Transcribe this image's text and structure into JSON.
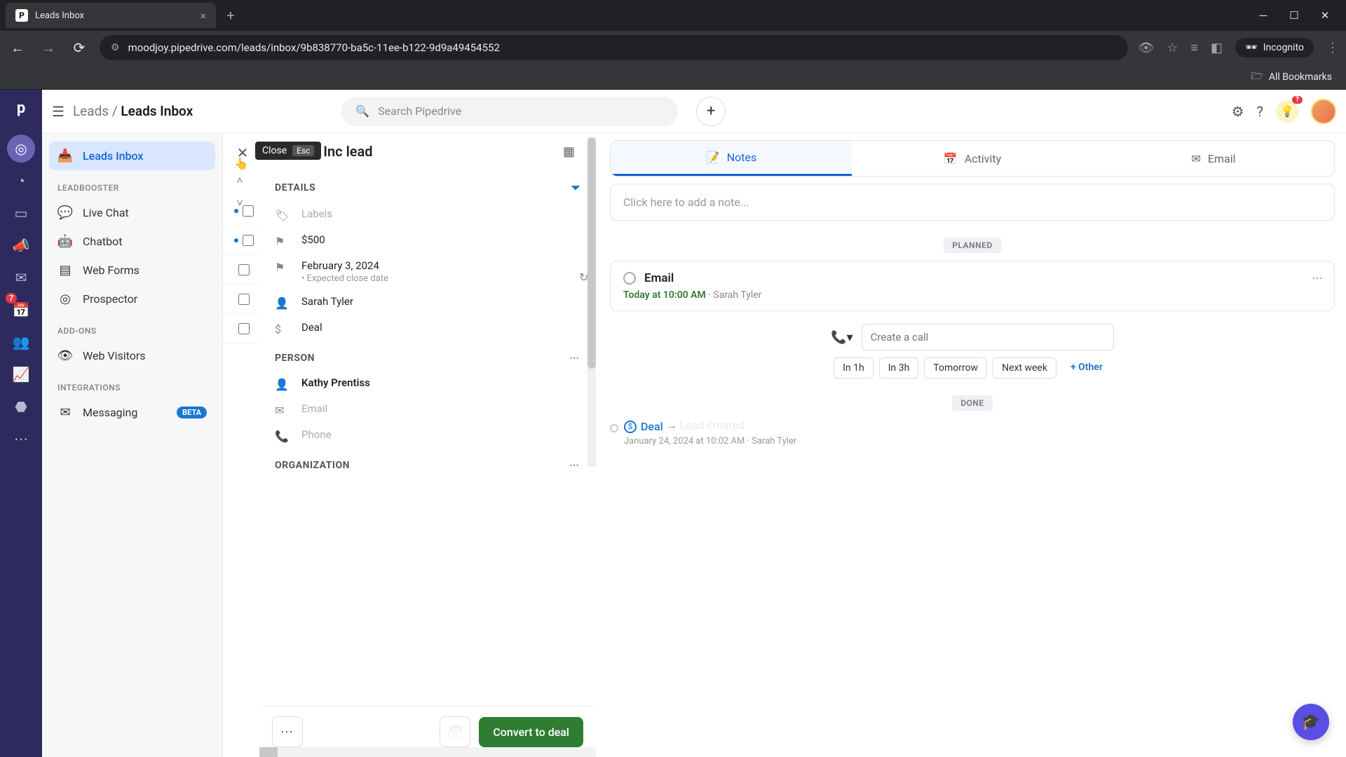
{
  "browser": {
    "tab_title": "Leads Inbox",
    "url": "moodjoy.pipedrive.com/leads/inbox/9b838770-ba5c-11ee-b122-9d9a49454552",
    "incognito_label": "Incognito",
    "all_bookmarks": "All Bookmarks"
  },
  "topbar": {
    "breadcrumb_root": "Leads",
    "breadcrumb_current": "Leads Inbox",
    "search_placeholder": "Search Pipedrive",
    "notification_count": "?"
  },
  "rail": {
    "badge_count": "7"
  },
  "sidebar": {
    "items": [
      {
        "label": "Leads Inbox",
        "active": true
      },
      {
        "label": "Live Chat"
      },
      {
        "label": "Chatbot"
      },
      {
        "label": "Web Forms"
      },
      {
        "label": "Prospector"
      },
      {
        "label": "Web Visitors"
      },
      {
        "label": "Messaging",
        "badge": "BETA"
      }
    ],
    "heading_leadbooster": "LEADBOOSTER",
    "heading_addons": "ADD-ONS",
    "heading_integrations": "INTEGRATIONS"
  },
  "detail": {
    "lead_title_suffix": "s Inc lead",
    "tooltip_close": "Close",
    "tooltip_esc": "Esc",
    "section_details": "DETAILS",
    "labels_placeholder": "Labels",
    "value": "$500",
    "close_date": "February 3, 2024",
    "close_date_sub": "Expected close date",
    "owner": "Sarah Tyler",
    "deal": "Deal",
    "section_person": "PERSON",
    "person_name": "Kathy Prentiss",
    "email_placeholder": "Email",
    "phone_placeholder": "Phone",
    "section_org": "ORGANIZATION",
    "convert_label": "Convert to deal"
  },
  "activity": {
    "tabs": {
      "notes": "Notes",
      "activity": "Activity",
      "email": "Email"
    },
    "note_placeholder": "Click here to add a note...",
    "label_planned": "PLANNED",
    "label_done": "DONE",
    "planned_card": {
      "title": "Email",
      "when": "Today at 10:00 AM",
      "who": "Sarah Tyler"
    },
    "call_placeholder": "Create a call",
    "chips": {
      "h1": "In 1h",
      "h3": "In 3h",
      "tomorrow": "Tomorrow",
      "nextweek": "Next week",
      "other": "+ Other"
    },
    "done_entry": {
      "deal_label": "Deal",
      "event": "Lead created",
      "when": "January 24, 2024 at 10:02 AM",
      "who": "Sarah Tyler"
    }
  }
}
